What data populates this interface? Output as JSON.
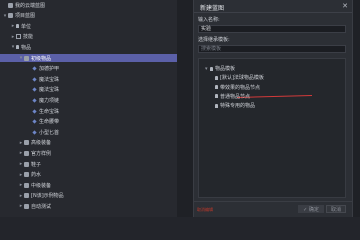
{
  "tree": {
    "rows": [
      {
        "label": "我的云端蓝图",
        "depth": 0,
        "toggle": "",
        "icon": "folder"
      },
      {
        "label": "项目蓝图",
        "depth": 0,
        "toggle": "▾",
        "icon": "folder"
      },
      {
        "label": "单位",
        "depth": 1,
        "toggle": "▸",
        "icon": "person"
      },
      {
        "label": "技能",
        "depth": 1,
        "toggle": "▸",
        "icon": "box"
      },
      {
        "label": "物品",
        "depth": 1,
        "toggle": "▾",
        "icon": "person"
      },
      {
        "label": "初级物品",
        "depth": 2,
        "toggle": "▾",
        "icon": "folder",
        "selected": true
      },
      {
        "label": "加德护甲",
        "depth": 3,
        "toggle": "",
        "icon": "gem"
      },
      {
        "label": "魔法宝珠",
        "depth": 3,
        "toggle": "",
        "icon": "gem"
      },
      {
        "label": "魔法宝珠",
        "depth": 3,
        "toggle": "",
        "icon": "gem"
      },
      {
        "label": "魔力项链",
        "depth": 3,
        "toggle": "",
        "icon": "gem"
      },
      {
        "label": "生命宝珠",
        "depth": 3,
        "toggle": "",
        "icon": "gem"
      },
      {
        "label": "生命腰带",
        "depth": 3,
        "toggle": "",
        "icon": "gem"
      },
      {
        "label": "小型匕首",
        "depth": 3,
        "toggle": "",
        "icon": "gem"
      },
      {
        "label": "高级装备",
        "depth": 2,
        "toggle": "▸",
        "icon": "folder"
      },
      {
        "label": "官方样例",
        "depth": 2,
        "toggle": "▸",
        "icon": "folder"
      },
      {
        "label": "鞋子",
        "depth": 2,
        "toggle": "▸",
        "icon": "folder"
      },
      {
        "label": "药水",
        "depth": 2,
        "toggle": "▸",
        "icon": "folder"
      },
      {
        "label": "中级装备",
        "depth": 2,
        "toggle": "▸",
        "icon": "folder"
      },
      {
        "label": "[N该]示例物品",
        "depth": 2,
        "toggle": "▸",
        "icon": "folder"
      },
      {
        "label": "自动测试",
        "depth": 2,
        "toggle": "▸",
        "icon": "folder"
      }
    ]
  },
  "dialog": {
    "title": "新建蓝图",
    "close": "✕",
    "name_label": "输入名称:",
    "name_value": "实验",
    "template_label": "选择继承模板:",
    "search_placeholder": "搜索模板",
    "templates": [
      {
        "label": "物品模板",
        "indent": 0,
        "toggle": "▾"
      },
      {
        "label": "[默认]法球物品模板",
        "indent": 1,
        "toggle": ""
      },
      {
        "label": "带效果的物品节点",
        "indent": 1,
        "toggle": ""
      },
      {
        "label": "普通物品节点",
        "indent": 1,
        "toggle": ""
      },
      {
        "label": "特殊专用的物品",
        "indent": 1,
        "toggle": ""
      }
    ],
    "footer_note": "取消编辑",
    "ok_label": "✓ 确定",
    "cancel_label": "取消"
  },
  "colors": {
    "selection": "#5b60a8",
    "annotation": "#d23a3a"
  }
}
